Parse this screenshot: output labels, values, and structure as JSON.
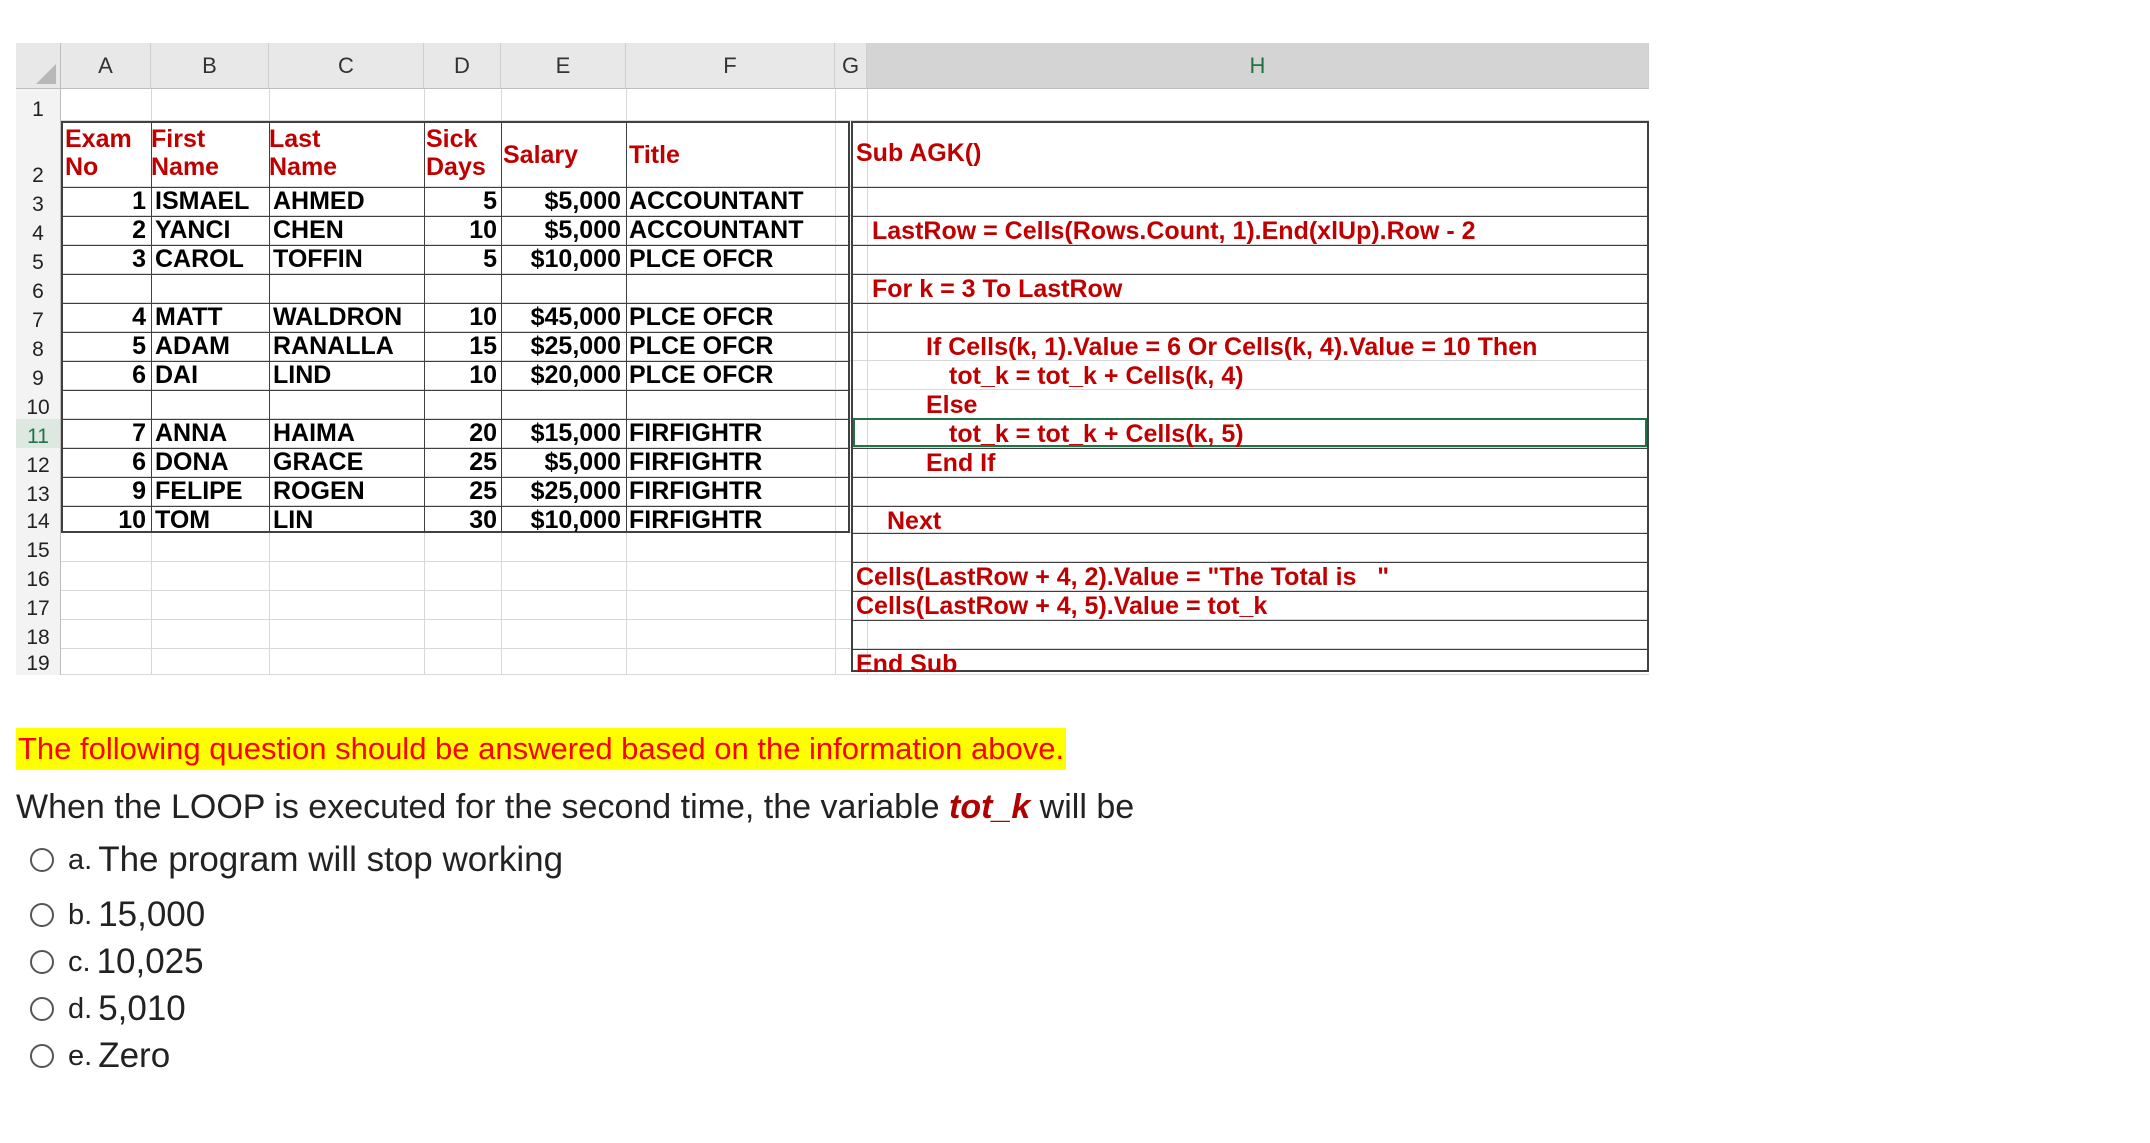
{
  "sheet": {
    "columns": [
      "A",
      "B",
      "C",
      "D",
      "E",
      "F",
      "G",
      "H"
    ],
    "rows": [
      "1",
      "2",
      "3",
      "4",
      "5",
      "6",
      "7",
      "8",
      "9",
      "10",
      "11",
      "12",
      "13",
      "14",
      "15",
      "16",
      "17",
      "18",
      "19"
    ],
    "headers": {
      "exam_no": [
        "Exam",
        "No"
      ],
      "first_name": [
        "First",
        "Name"
      ],
      "last_name": [
        "Last",
        "Name"
      ],
      "sick_days": [
        "Sick",
        "Days"
      ],
      "salary": "Salary",
      "title": "Title"
    },
    "data_rows": [
      {
        "row": 3,
        "exam": "1",
        "first": "ISMAEL",
        "last": "AHMED",
        "sick": "5",
        "salary": "$5,000",
        "title": "ACCOUNTANT"
      },
      {
        "row": 4,
        "exam": "2",
        "first": "YANCI",
        "last": "CHEN",
        "sick": "10",
        "salary": "$5,000",
        "title": "ACCOUNTANT"
      },
      {
        "row": 5,
        "exam": "3",
        "first": "CAROL",
        "last": "TOFFIN",
        "sick": "5",
        "salary": "$10,000",
        "title": "PLCE OFCR"
      },
      {
        "row": 7,
        "exam": "4",
        "first": "MATT",
        "last": "WALDRON",
        "sick": "10",
        "salary": "$45,000",
        "title": "PLCE OFCR"
      },
      {
        "row": 8,
        "exam": "5",
        "first": "ADAM",
        "last": "RANALLA",
        "sick": "15",
        "salary": "$25,000",
        "title": "PLCE OFCR"
      },
      {
        "row": 9,
        "exam": "6",
        "first": "DAI",
        "last": "LIND",
        "sick": "10",
        "salary": "$20,000",
        "title": "PLCE OFCR"
      },
      {
        "row": 11,
        "exam": "7",
        "first": "ANNA",
        "last": "HAIMA",
        "sick": "20",
        "salary": "$15,000",
        "title": "FIRFIGHTR"
      },
      {
        "row": 12,
        "exam": "6",
        "first": "DONA",
        "last": "GRACE",
        "sick": "25",
        "salary": "$5,000",
        "title": "FIRFIGHTR"
      },
      {
        "row": 13,
        "exam": "9",
        "first": "FELIPE",
        "last": "ROGEN",
        "sick": "25",
        "salary": "$25,000",
        "title": "FIRFIGHTR"
      },
      {
        "row": 14,
        "exam": "10",
        "first": "TOM",
        "last": "LIN",
        "sick": "30",
        "salary": "$10,000",
        "title": "FIRFIGHTR"
      }
    ],
    "code_lines": [
      {
        "row": 2,
        "text": "Sub AGK()"
      },
      {
        "row": 4,
        "text": "LastRow = Cells(Rows.Count, 1).End(xlUp).Row - 2"
      },
      {
        "row": 6,
        "text": "For k = 3 To LastRow"
      },
      {
        "row": 8,
        "text": "If Cells(k, 1).Value = 6 Or Cells(k, 4).Value = 10 Then"
      },
      {
        "row": 9,
        "text": "tot_k = tot_k + Cells(k, 4)"
      },
      {
        "row": 10,
        "text": "Else"
      },
      {
        "row": 11,
        "text": "tot_k = tot_k + Cells(k, 5)"
      },
      {
        "row": 12,
        "text": "End If"
      },
      {
        "row": 14,
        "text": "Next"
      },
      {
        "row": 16,
        "text": "Cells(LastRow + 4, 2).Value = \"The Total is   \""
      },
      {
        "row": 17,
        "text": "Cells(LastRow + 4, 5).Value = tot_k"
      },
      {
        "row": 19,
        "text": "End Sub"
      }
    ],
    "selected_column": "H",
    "selected_row": "11"
  },
  "notice": "The following question should be answered based on the information above.",
  "question": {
    "prefix": "When the LOOP is executed for the second time, the variable ",
    "variable": "tot_k",
    "suffix": " will be"
  },
  "options": [
    {
      "letter": "a.",
      "text": "The program will stop working"
    },
    {
      "letter": "b.",
      "text": "15,000"
    },
    {
      "letter": "c.",
      "text": "10,025"
    },
    {
      "letter": "d.",
      "text": "5,010"
    },
    {
      "letter": "e.",
      "text": "Zero"
    }
  ],
  "colors": {
    "accent_red": "#c00000",
    "notice_bg": "#ffff00",
    "notice_text": "#ff0000",
    "excel_green": "#217346"
  }
}
